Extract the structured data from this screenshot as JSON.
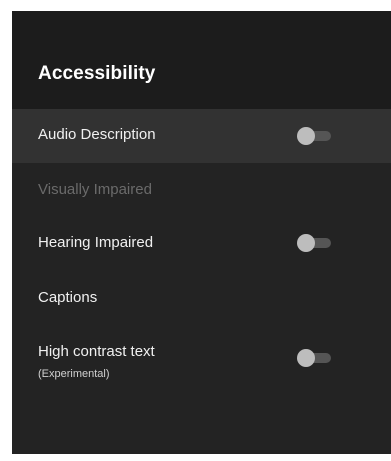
{
  "header": {
    "title": "Accessibility"
  },
  "settings": {
    "items": [
      {
        "label": "Audio Description",
        "toggle": "off",
        "focused": true
      },
      {
        "label": "Visually Impaired",
        "disabled": true
      },
      {
        "label": "Hearing Impaired",
        "toggle": "off"
      },
      {
        "label": "Captions"
      },
      {
        "label": "High contrast text",
        "sublabel": "(Experimental)",
        "toggle": "off"
      }
    ]
  },
  "colors": {
    "panel_background": "#232323",
    "header_background": "#1c1c1c",
    "focused_row": "#323232",
    "toggle_thumb_off": "#bdbdbd",
    "toggle_track_off": "#555555"
  }
}
